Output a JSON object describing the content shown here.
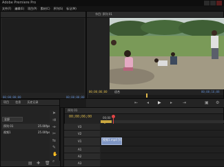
{
  "app": {
    "title": "Adobe Premiere Pro",
    "menu": [
      "文件(F)",
      "编辑(E)",
      "项目(P)",
      "素材(C)",
      "序列(S)",
      "标记(M)"
    ]
  },
  "source_monitor": {
    "timecode_left": "00;00;00;00",
    "timecode_right": "00;00;00;00"
  },
  "program_monitor": {
    "tab": "节目: 序列 01",
    "timecode_left": "00;00;06;00",
    "fit_label": "适合",
    "timecode_right": "00;00;16;08"
  },
  "project_panel": {
    "tabs": [
      "项目",
      "信息",
      "历史记录"
    ],
    "dropdown": "全部",
    "rows": [
      {
        "name": "序列 01",
        "rate": "25.00fps"
      },
      {
        "name": "视频1",
        "rate": "25.00fps"
      }
    ]
  },
  "timeline": {
    "tab": "序列 01",
    "timecode": "00;00;06;00",
    "ruler_start": "00;00",
    "tracks": [
      "V3",
      "V2",
      "V1",
      "A1",
      "A2",
      "A3"
    ],
    "clip_label": "视频1.mp4 [V]"
  },
  "colors": {
    "accent_timecode": "#d9b74a",
    "playhead": "#e14545",
    "clip_video": "#7f96c4",
    "monitor_timecode": "#5f88c7"
  }
}
